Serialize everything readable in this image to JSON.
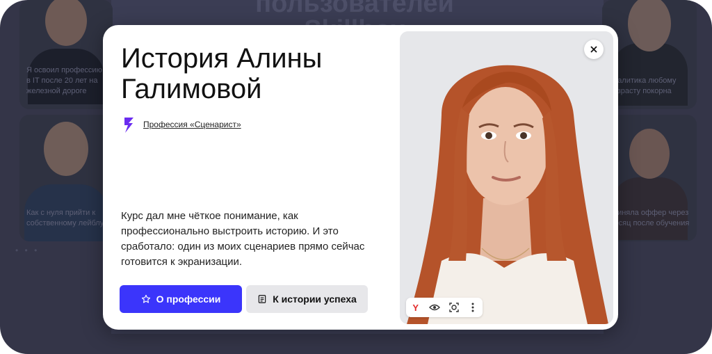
{
  "background": {
    "headline_line1": "пользователей",
    "headline_line2": "Skillbox",
    "cards": [
      {
        "caption": "Я освоил профессию в IT после 20 лет на железной дороге"
      },
      {
        "caption": "Как с нуля прийти к собственному лейблу"
      },
      {
        "caption": "аналитика любому возрасту покорна"
      },
      {
        "caption": "приняла оффер через месяц после обучения"
      }
    ]
  },
  "modal": {
    "title_line1": "История Алины",
    "title_line2": "Галимовой",
    "profession_link": "Профессия «Сценарист»",
    "quote": "Курс дал мне чёткое понимание, как профессионально выстроить историю. И это сработало: один из моих сценариев прямо сейчас готовится к экранизации.",
    "primary_button": "О профессии",
    "secondary_button": "К истории успеха",
    "toolbar_logo": "Y"
  },
  "colors": {
    "accent": "#3b35fb",
    "overlay": "#343548",
    "logo": "#6a2cf0"
  },
  "icons": {
    "close": "close-icon",
    "star": "star-icon",
    "document": "document-icon",
    "eye": "eye-icon",
    "lens": "lens-search-icon",
    "more": "more-vertical-icon"
  }
}
